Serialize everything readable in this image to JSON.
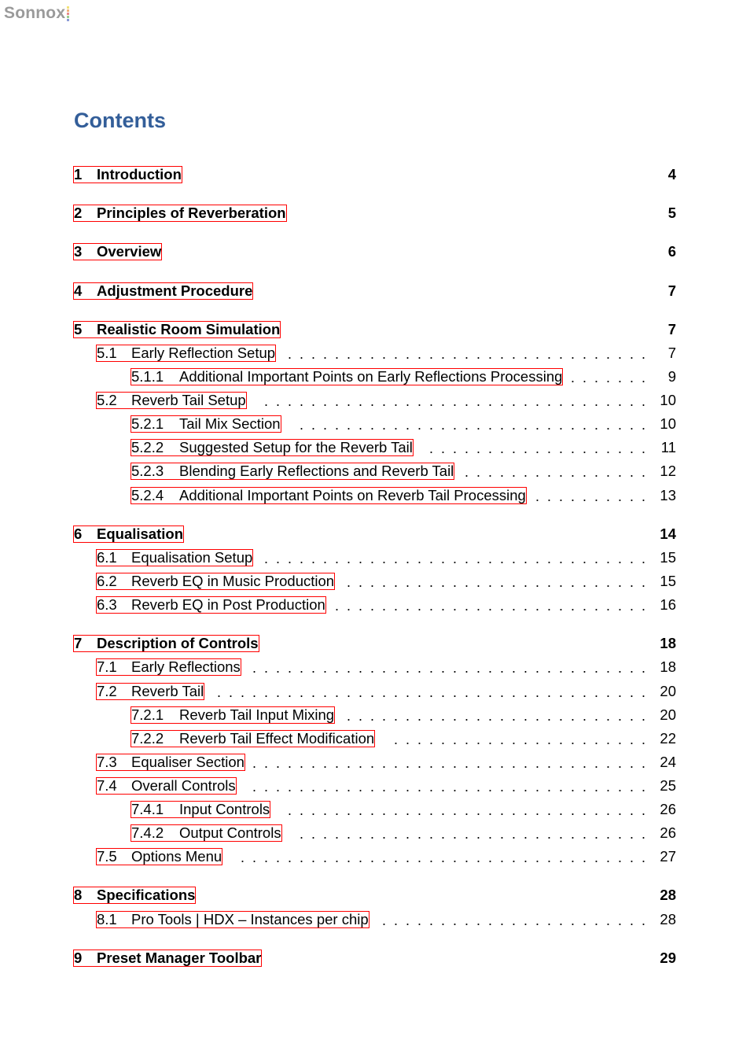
{
  "header": {
    "logo_text": "Sonnox",
    "logo_dot_colors": [
      "#f2e27a",
      "#f0b27a",
      "#e88a8a",
      "#9bcf8f",
      "#8a9ad6"
    ]
  },
  "document": {
    "heading": "Contents",
    "link_border_color": "#ff0000",
    "heading_color": "#335e99"
  },
  "toc": [
    {
      "level": 1,
      "number": "1",
      "title": "Introduction",
      "page": "4"
    },
    {
      "level": 1,
      "number": "2",
      "title": "Principles of Reverberation",
      "page": "5"
    },
    {
      "level": 1,
      "number": "3",
      "title": "Overview",
      "page": "6"
    },
    {
      "level": 1,
      "number": "4",
      "title": "Adjustment Procedure",
      "page": "7"
    },
    {
      "level": 1,
      "number": "5",
      "title": "Realistic Room Simulation",
      "page": "7"
    },
    {
      "level": 2,
      "number": "5.1",
      "title": "Early Reflection Setup",
      "page": "7"
    },
    {
      "level": 3,
      "number": "5.1.1",
      "title": "Additional Important Points on Early Reflections Processing",
      "page": "9"
    },
    {
      "level": 2,
      "number": "5.2",
      "title": "Reverb Tail Setup",
      "page": "10"
    },
    {
      "level": 3,
      "number": "5.2.1",
      "title": "Tail Mix Section",
      "page": "10"
    },
    {
      "level": 3,
      "number": "5.2.2",
      "title": "Suggested Setup for the Reverb Tail",
      "page": "11"
    },
    {
      "level": 3,
      "number": "5.2.3",
      "title": "Blending Early Reflections and Reverb Tail",
      "page": "12"
    },
    {
      "level": 3,
      "number": "5.2.4",
      "title": "Additional Important Points on Reverb Tail Processing",
      "page": "13"
    },
    {
      "level": 1,
      "number": "6",
      "title": "Equalisation",
      "page": "14"
    },
    {
      "level": 2,
      "number": "6.1",
      "title": "Equalisation Setup",
      "page": "15"
    },
    {
      "level": 2,
      "number": "6.2",
      "title": "Reverb EQ in Music Production",
      "page": "15"
    },
    {
      "level": 2,
      "number": "6.3",
      "title": "Reverb EQ in Post Production",
      "page": "16"
    },
    {
      "level": 1,
      "number": "7",
      "title": "Description of Controls",
      "page": "18"
    },
    {
      "level": 2,
      "number": "7.1",
      "title": "Early Reflections",
      "page": "18"
    },
    {
      "level": 2,
      "number": "7.2",
      "title": "Reverb Tail",
      "page": "20"
    },
    {
      "level": 3,
      "number": "7.2.1",
      "title": "Reverb Tail Input Mixing",
      "page": "20"
    },
    {
      "level": 3,
      "number": "7.2.2",
      "title": "Reverb Tail Effect Modification",
      "page": "22"
    },
    {
      "level": 2,
      "number": "7.3",
      "title": "Equaliser Section",
      "page": "24"
    },
    {
      "level": 2,
      "number": "7.4",
      "title": "Overall Controls",
      "page": "25"
    },
    {
      "level": 3,
      "number": "7.4.1",
      "title": "Input Controls",
      "page": "26"
    },
    {
      "level": 3,
      "number": "7.4.2",
      "title": "Output Controls",
      "page": "26"
    },
    {
      "level": 2,
      "number": "7.5",
      "title": "Options Menu",
      "page": "27"
    },
    {
      "level": 1,
      "number": "8",
      "title": "Specifications",
      "page": "28"
    },
    {
      "level": 2,
      "number": "8.1",
      "title": "Pro Tools | HDX – Instances per chip",
      "page": "28"
    },
    {
      "level": 1,
      "number": "9",
      "title": "Preset Manager Toolbar",
      "page": "29"
    }
  ]
}
